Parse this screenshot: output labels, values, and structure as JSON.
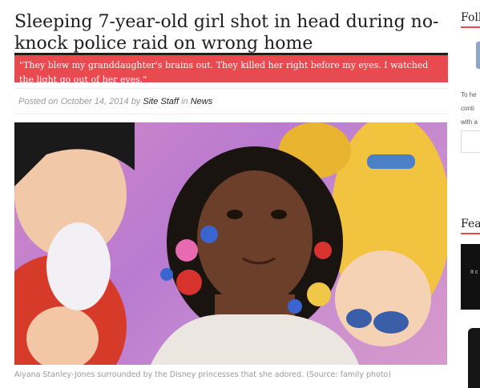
{
  "article": {
    "headline": "Sleeping 7-year-old girl shot in head during no-knock police raid on wrong home",
    "pullquote": "\"They blew my granddaughter's brains out. They killed her right before my eyes. I watched the light go out of her eyes.\"",
    "meta": {
      "posted_on_label": "Posted on",
      "date": "October 14, 2014",
      "by_label": "by",
      "author": "Site Staff",
      "in_label": "in",
      "category": "News"
    },
    "photo_caption": "Aiyana Stanley-Jones surrounded by the Disney princesses that she adored. (Source: family photo)"
  },
  "sidebar": {
    "follow_heading": "Foll",
    "text_line_1": "To he",
    "text_line_2": "conti",
    "text_line_3": "with a",
    "featured_heading": "Feat",
    "featured_dark_text": "It c"
  },
  "colors": {
    "accent": "#e84a4f",
    "quote_border": "#1c1c1c",
    "meta_text": "#9a9a9a"
  }
}
